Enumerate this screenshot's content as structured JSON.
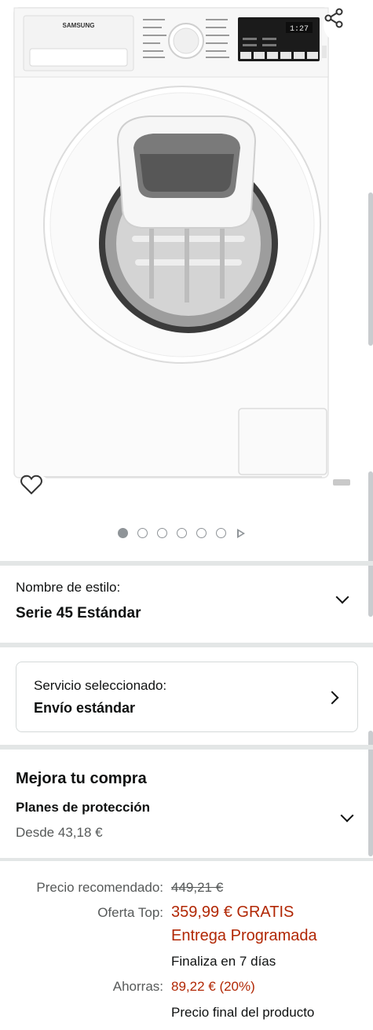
{
  "product_image": {
    "brand": "SAMSUNG",
    "display_readout": "1:27",
    "carousel_total_dots": 6
  },
  "style": {
    "label": "Nombre de estilo:",
    "value": "Serie 45 Estándar"
  },
  "service": {
    "label": "Servicio seleccionado:",
    "value": "Envío estándar"
  },
  "upgrade": {
    "heading": "Mejora tu compra",
    "plans_title": "Planes de protección",
    "plans_price": "Desde 43,18 €"
  },
  "pricing": {
    "recommended_label": "Precio recomendado:",
    "recommended_value": "449,21 €",
    "offer_label": "Oferta Top:",
    "offer_line1": "359,99 € GRATIS",
    "offer_line2": "Entrega Programada",
    "offer_ends": "Finaliza en 7 días",
    "savings_label": "Ahorras:",
    "savings_value": "89,22 € (20%)",
    "final_note": "Precio final del producto"
  },
  "colors": {
    "price_red": "#b12704",
    "divider": "#e3e6e6",
    "text": "#0f1111",
    "muted": "#565959"
  }
}
